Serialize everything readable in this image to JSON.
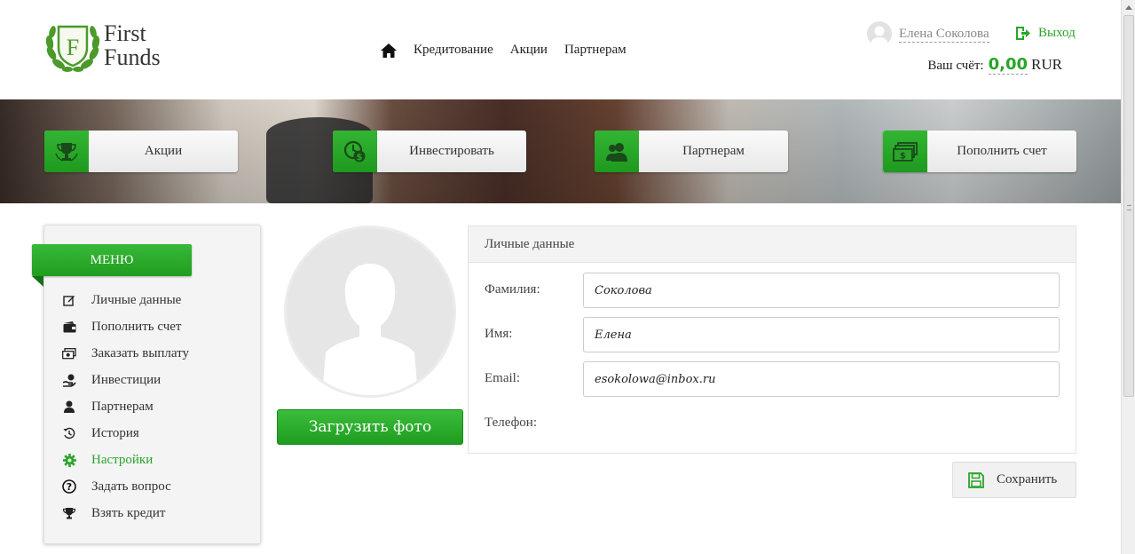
{
  "brand": {
    "line1": "First",
    "line2": "Funds",
    "color": "#2aa52a"
  },
  "nav": {
    "home_icon": "home-icon",
    "items": [
      "Кредитование",
      "Акции",
      "Партнерам"
    ]
  },
  "user": {
    "name": "Елена Соколова",
    "logout": "Выход"
  },
  "balance": {
    "label": "Ваш счёт:",
    "amount": "0,00",
    "currency": "RUR"
  },
  "quick": [
    {
      "label": "Акции",
      "icon": "trophy-icon"
    },
    {
      "label": "Инвестировать",
      "icon": "clock-dollar-icon"
    },
    {
      "label": "Партнерам",
      "icon": "users-icon"
    },
    {
      "label": "Пополнить счет",
      "icon": "cash-icon"
    }
  ],
  "menu": {
    "title": "МЕНЮ",
    "items": [
      {
        "label": "Личные данные",
        "icon": "edit-icon"
      },
      {
        "label": "Пополнить счет",
        "icon": "wallet-icon"
      },
      {
        "label": "Заказать выплату",
        "icon": "money-icon"
      },
      {
        "label": "Инвестиции",
        "icon": "hand-coin-icon"
      },
      {
        "label": "Партнерам",
        "icon": "user-icon"
      },
      {
        "label": "История",
        "icon": "history-icon"
      },
      {
        "label": "Настройки",
        "icon": "gear-icon",
        "active": true
      },
      {
        "label": "Задать вопрос",
        "icon": "question-icon"
      },
      {
        "label": "Взять кредит",
        "icon": "trophy-icon"
      }
    ]
  },
  "photo": {
    "upload_label": "Загрузить фото"
  },
  "form": {
    "title": "Личные данные",
    "fields": [
      {
        "label": "Фамилия:",
        "value": "Соколова"
      },
      {
        "label": "Имя:",
        "value": "Елена"
      },
      {
        "label": "Email:",
        "value": "esokolowa@inbox.ru"
      },
      {
        "label": "Телефон:",
        "value": ""
      }
    ],
    "save_label": "Сохранить"
  }
}
